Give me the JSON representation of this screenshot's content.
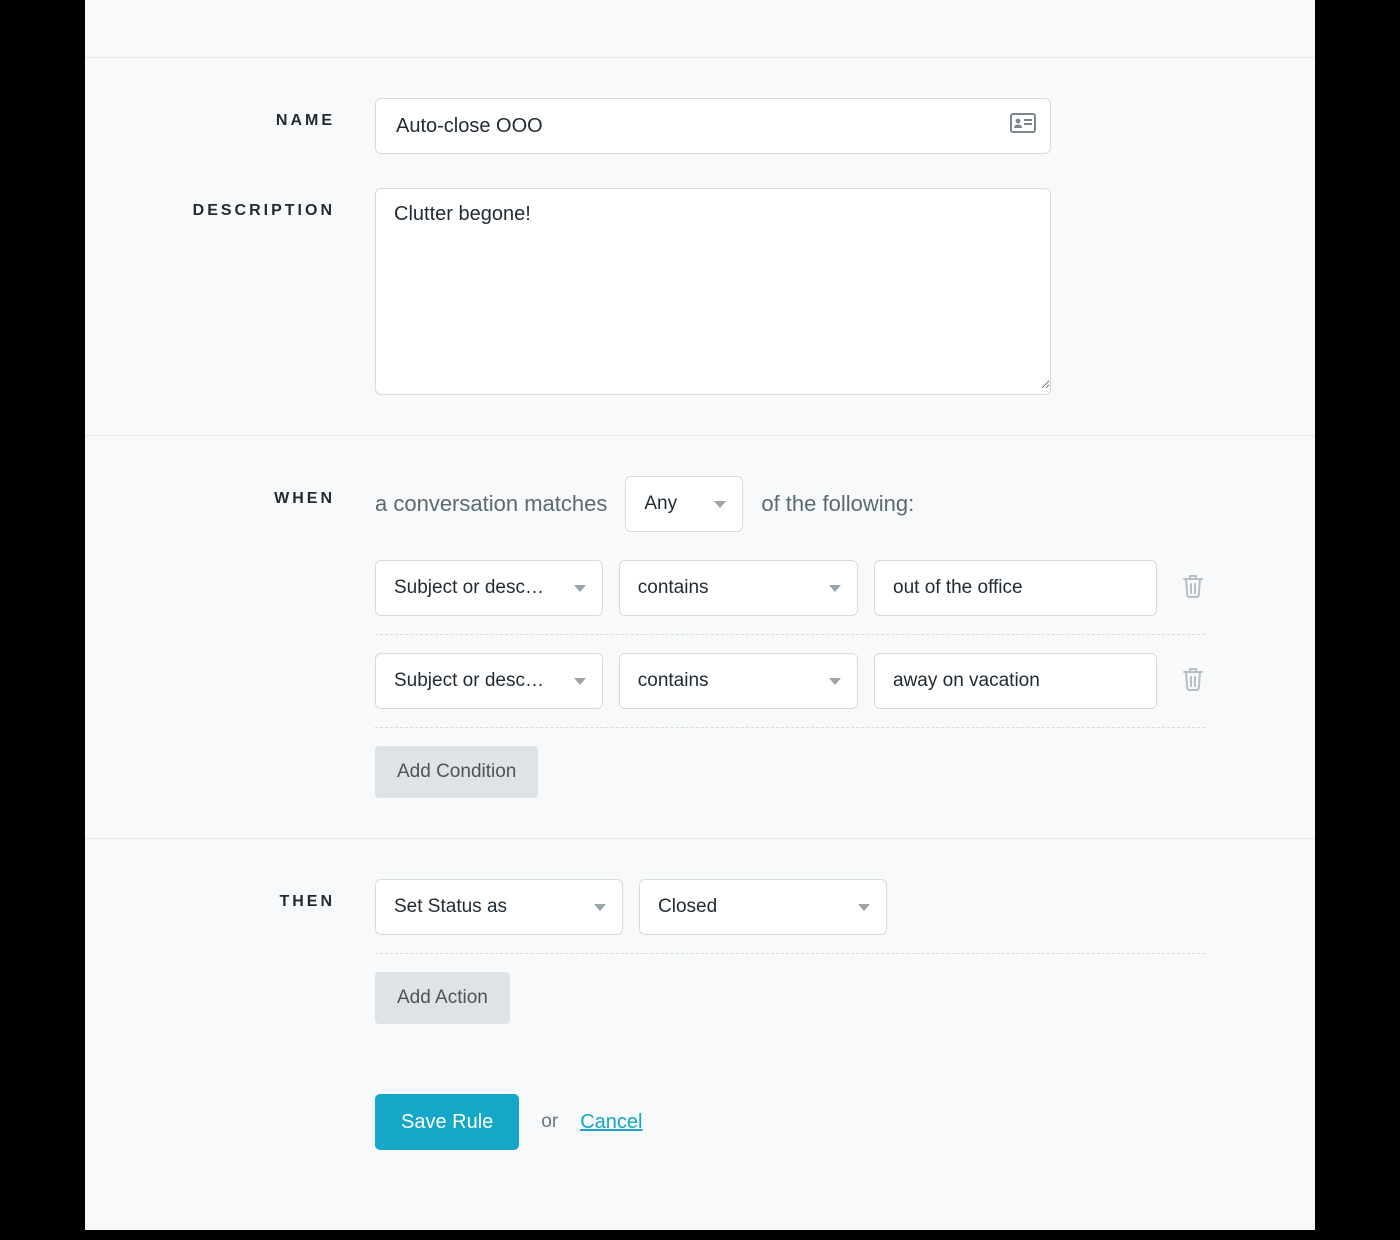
{
  "labels": {
    "name": "NAME",
    "description": "DESCRIPTION",
    "when": "WHEN",
    "then": "THEN"
  },
  "name_value": "Auto-close OOO",
  "description_value": "Clutter begone!",
  "when": {
    "intro_prefix": "a conversation matches",
    "match_mode": "Any",
    "intro_suffix": "of the following:",
    "conditions": [
      {
        "field": "Subject or desc…",
        "operator": "contains",
        "value": "out of the office"
      },
      {
        "field": "Subject or desc…",
        "operator": "contains",
        "value": "away on vacation"
      }
    ],
    "add_condition_label": "Add Condition"
  },
  "then": {
    "actions": [
      {
        "action": "Set Status as",
        "value": "Closed"
      }
    ],
    "add_action_label": "Add Action"
  },
  "footer": {
    "save_label": "Save Rule",
    "or_label": "or",
    "cancel_label": "Cancel"
  }
}
